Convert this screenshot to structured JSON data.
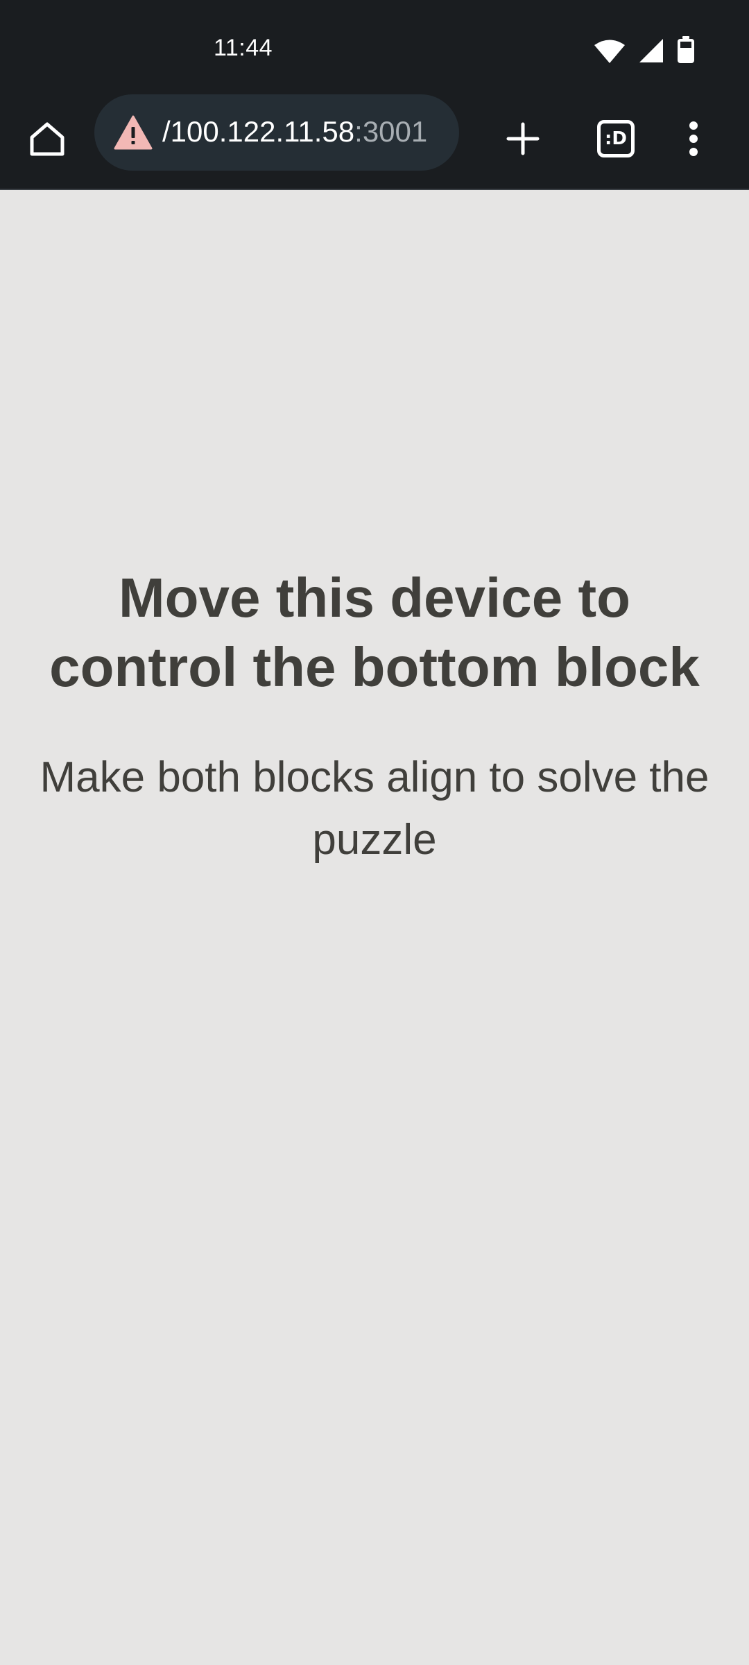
{
  "status_bar": {
    "time": "11:44",
    "icons": [
      "wifi-icon",
      "signal-icon",
      "battery-icon"
    ]
  },
  "toolbar": {
    "home_icon": "home-icon",
    "security_icon": "warning-icon",
    "url_visible": "/100.122.11.58",
    "url_port": ":3001",
    "new_tab_icon": "plus-icon",
    "tabs_label": ":D",
    "menu_icon": "more-vert-icon"
  },
  "page": {
    "headline": "Move this device to control the bottom block",
    "subtext": "Make both blocks align to solve the puzzle"
  },
  "colors": {
    "browser_chrome": "#1a1d20",
    "url_bar": "#252e35",
    "warning": "#f2b8b5",
    "page_background": "#e6e5e4",
    "text": "#403f3b"
  }
}
